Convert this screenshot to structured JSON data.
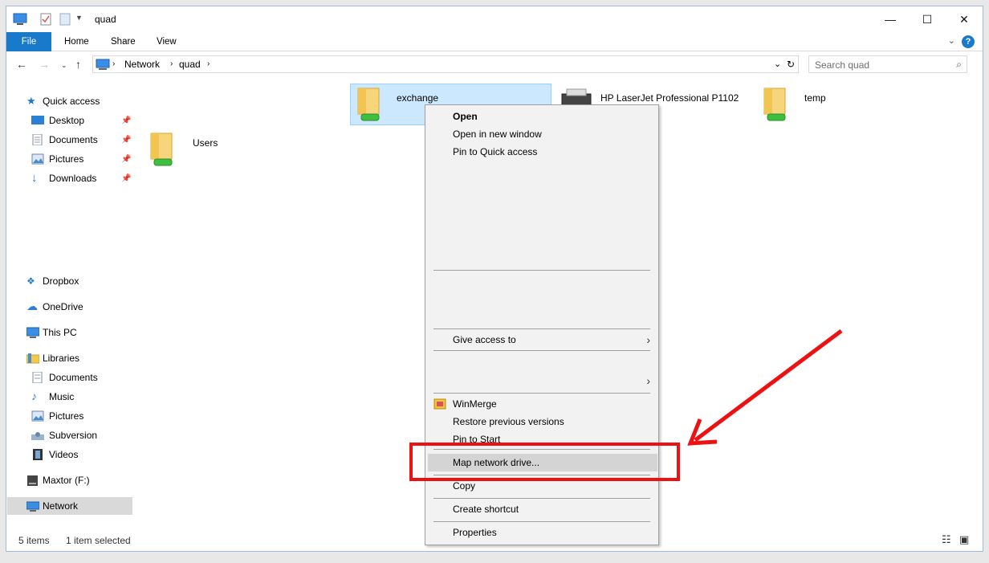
{
  "window": {
    "title": "quad",
    "controls": {
      "minimize": "—",
      "maximize": "☐",
      "close": "✕"
    }
  },
  "ribbon": {
    "tabs": [
      "File",
      "Home",
      "Share",
      "View"
    ],
    "help": "?"
  },
  "address_bar": {
    "crumbs": [
      "Network",
      "quad"
    ],
    "search_placeholder": "Search quad"
  },
  "sidebar": {
    "quick_access": "Quick access",
    "quick_items": [
      "Desktop",
      "Documents",
      "Pictures",
      "Downloads"
    ],
    "dropbox": "Dropbox",
    "onedrive": "OneDrive",
    "thispc": "This PC",
    "libraries": "Libraries",
    "library_items": [
      "Documents",
      "Music",
      "Pictures",
      "Subversion",
      "Videos"
    ],
    "maxtor": "Maxtor (F:)",
    "network": "Network"
  },
  "content": {
    "items": [
      "exchange",
      "HP LaserJet Professional P1102",
      "temp",
      "Users"
    ]
  },
  "status": {
    "count": "5 items",
    "selected": "1 item selected"
  },
  "context_menu": {
    "open": "Open",
    "open_new_window": "Open in new window",
    "pin_quick": "Pin to Quick access",
    "give_access": "Give access to",
    "winmerge": "WinMerge",
    "restore": "Restore previous versions",
    "pin_start": "Pin to Start",
    "map_drive": "Map network drive...",
    "copy": "Copy",
    "create_shortcut": "Create shortcut",
    "properties": "Properties"
  },
  "colors": {
    "accent": "#1979ca",
    "annotation": "#ee1111",
    "selection": "#cce8ff"
  }
}
